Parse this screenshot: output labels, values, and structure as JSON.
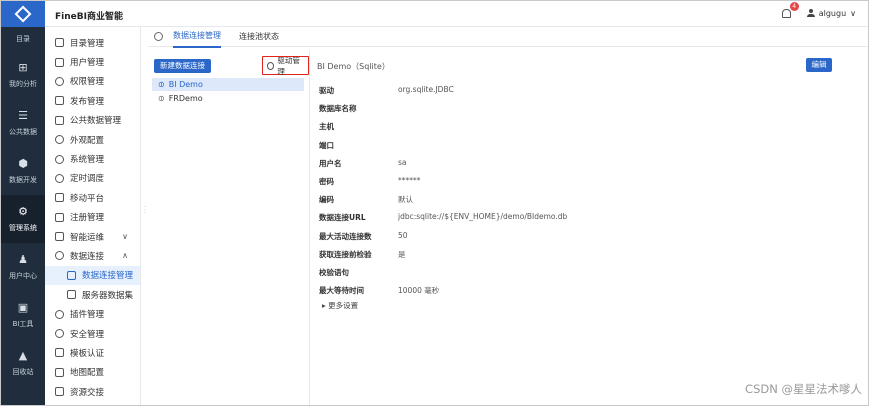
{
  "header": {
    "brand": "FineBI商业智能",
    "notification_count": "4",
    "username": "algugu",
    "user_chevron": "∨"
  },
  "rail": {
    "items": [
      {
        "label": "目录",
        "icon": "catalog-icon"
      },
      {
        "label": "我的分析",
        "icon": "analysis-icon"
      },
      {
        "label": "公共数据",
        "icon": "public-data-icon"
      },
      {
        "label": "数据开发",
        "icon": "data-dev-icon"
      },
      {
        "label": "管理系统",
        "icon": "admin-system-icon"
      },
      {
        "label": "用户中心",
        "icon": "user-center-icon"
      },
      {
        "label": "BI工具",
        "icon": "bi-tools-icon"
      },
      {
        "label": "回收站",
        "icon": "recycle-bin-icon"
      }
    ]
  },
  "menu": {
    "items": [
      {
        "label": "目录管理"
      },
      {
        "label": "用户管理"
      },
      {
        "label": "权限管理"
      },
      {
        "label": "发布管理"
      },
      {
        "label": "公共数据管理"
      },
      {
        "label": "外观配置"
      },
      {
        "label": "系统管理"
      },
      {
        "label": "定时调度"
      },
      {
        "label": "移动平台"
      },
      {
        "label": "注册管理"
      },
      {
        "label": "智能运维",
        "chevron": "∨"
      },
      {
        "label": "数据连接",
        "chevron": "∧"
      },
      {
        "label": "数据连接管理"
      },
      {
        "label": "服务器数据集"
      },
      {
        "label": "插件管理"
      },
      {
        "label": "安全管理"
      },
      {
        "label": "模板认证"
      },
      {
        "label": "地图配置"
      },
      {
        "label": "资源交接"
      }
    ]
  },
  "tabs": [
    "数据连接管理",
    "连接池状态"
  ],
  "list": {
    "new_button": "新建数据连接",
    "driver_button": "驱动管理",
    "connections": [
      "BI Demo",
      "FRDemo"
    ]
  },
  "detail": {
    "title": "BI Demo（Sqlite）",
    "edit_button": "编辑",
    "fields": [
      {
        "key": "驱动",
        "value": "org.sqlite.JDBC"
      },
      {
        "key": "数据库名称",
        "value": ""
      },
      {
        "key": "主机",
        "value": ""
      },
      {
        "key": "端口",
        "value": ""
      },
      {
        "key": "用户名",
        "value": "sa"
      },
      {
        "key": "密码",
        "value": "******"
      },
      {
        "key": "编码",
        "value": "默认"
      },
      {
        "key": "数据连接URL",
        "value": "jdbc:sqlite://${ENV_HOME}/demo/BIdemo.db"
      },
      {
        "key": "最大活动连接数",
        "value": "50"
      },
      {
        "key": "获取连接前检验",
        "value": "是"
      },
      {
        "key": "校验语句",
        "value": ""
      },
      {
        "key": "最大等待时间",
        "value": "10000 毫秒"
      }
    ],
    "more_settings": "▸ 更多设置"
  },
  "watermark": "CSDN @星星法术嗲人"
}
